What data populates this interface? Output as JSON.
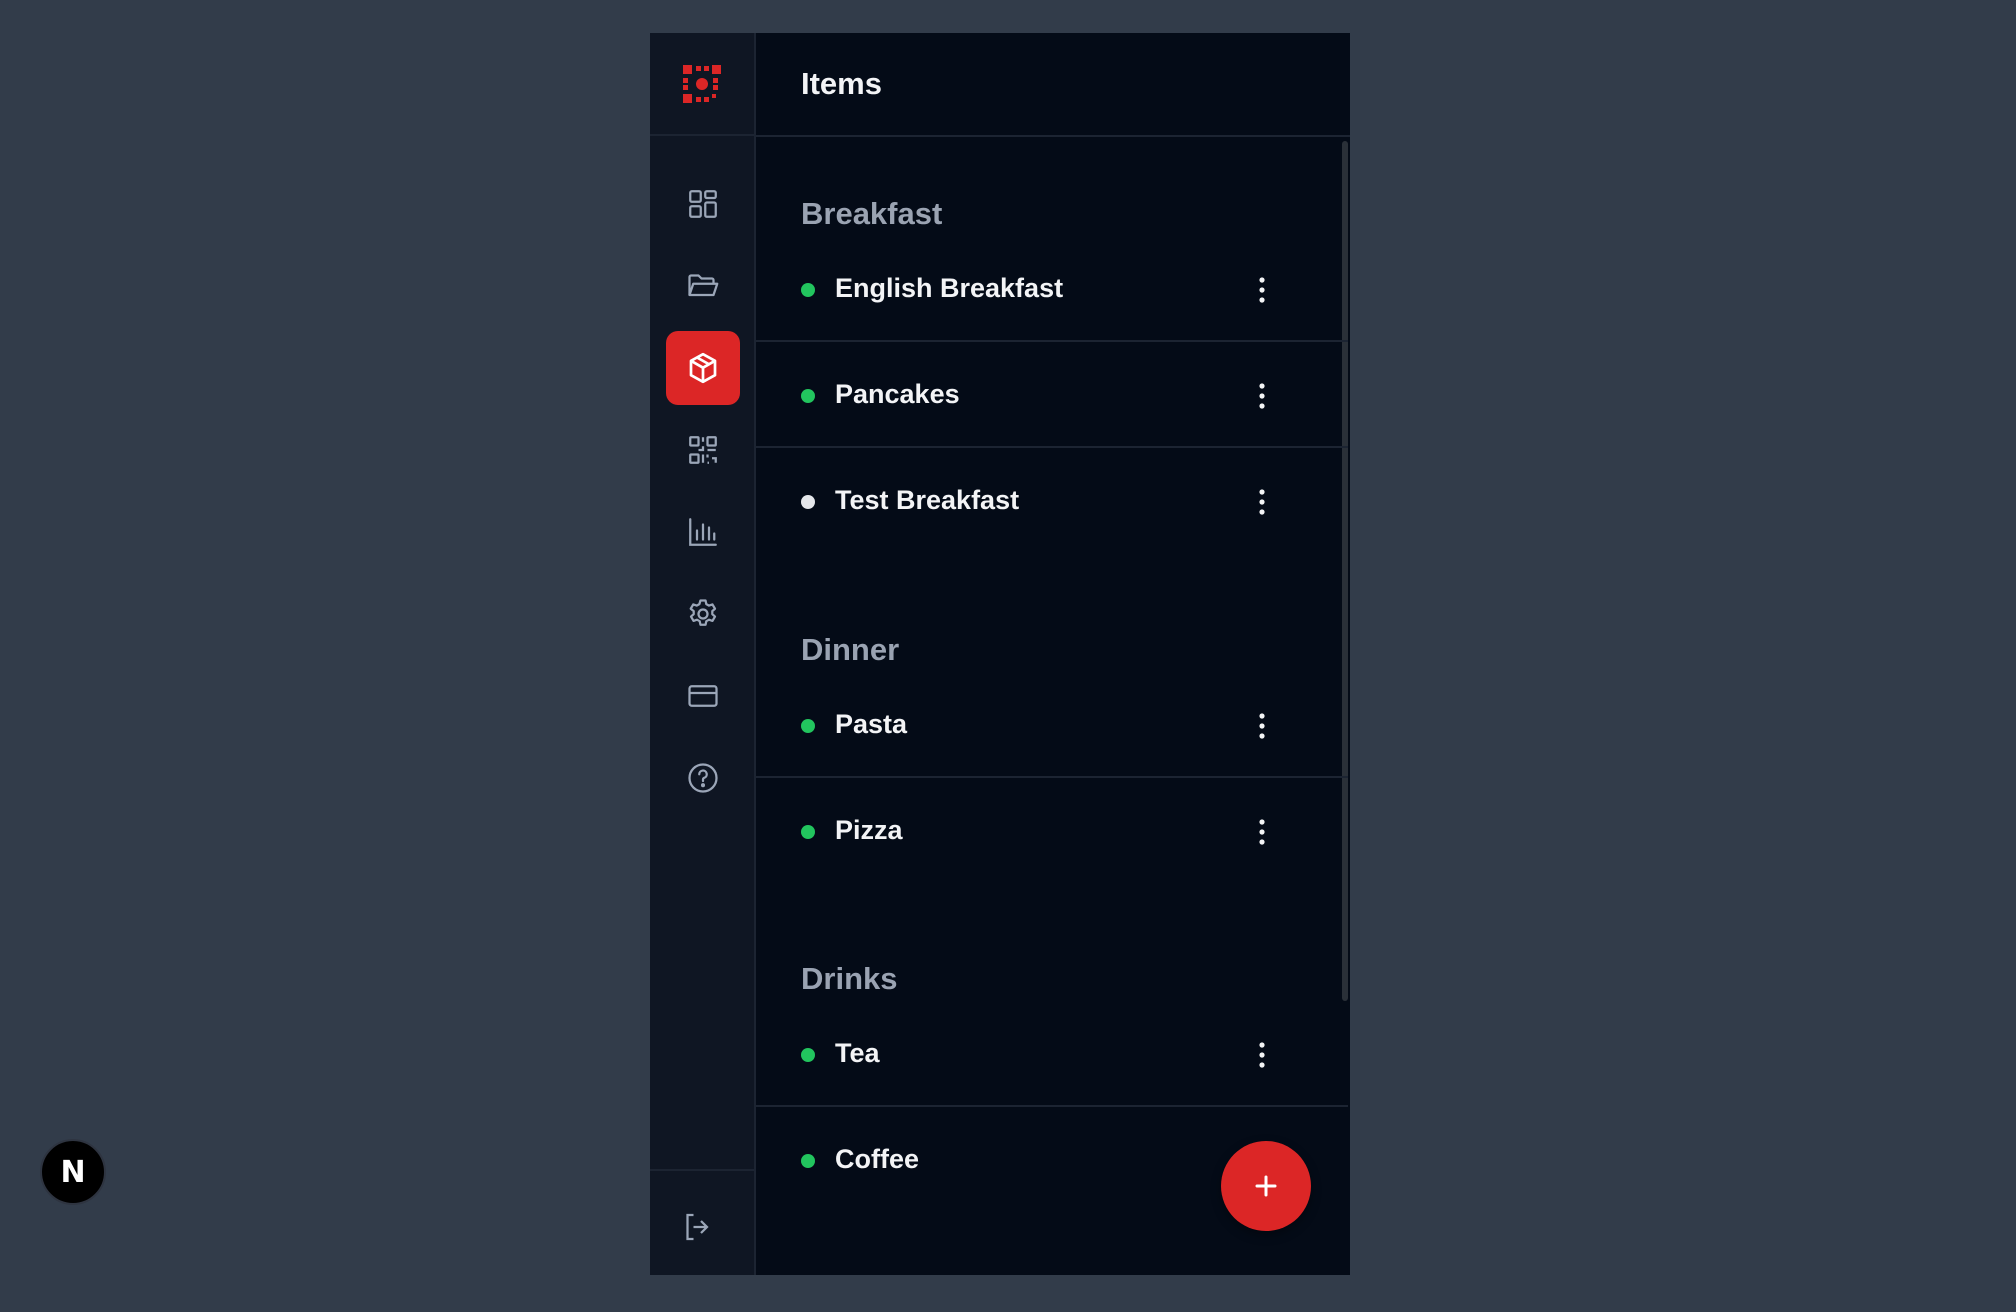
{
  "app": {
    "title": "Items"
  },
  "sidebar": {
    "logo": "app-logo",
    "items": [
      {
        "icon": "dashboard-icon",
        "active": false
      },
      {
        "icon": "folder-icon",
        "active": false
      },
      {
        "icon": "package-icon",
        "active": true
      },
      {
        "icon": "qr-code-icon",
        "active": false
      },
      {
        "icon": "bar-chart-icon",
        "active": false
      },
      {
        "icon": "gear-icon",
        "active": false
      },
      {
        "icon": "credit-card-icon",
        "active": false
      },
      {
        "icon": "help-icon",
        "active": false
      }
    ],
    "avatar_letter": "N"
  },
  "sections": [
    {
      "title": "Breakfast",
      "items": [
        {
          "label": "English Breakfast",
          "status": "active"
        },
        {
          "label": "Pancakes",
          "status": "active"
        },
        {
          "label": "Test Breakfast",
          "status": "inactive"
        }
      ]
    },
    {
      "title": "Dinner",
      "items": [
        {
          "label": "Pasta",
          "status": "active"
        },
        {
          "label": "Pizza",
          "status": "active"
        }
      ]
    },
    {
      "title": "Drinks",
      "items": [
        {
          "label": "Tea",
          "status": "active"
        },
        {
          "label": "Coffee",
          "status": "active"
        }
      ]
    }
  ],
  "fab": {
    "icon": "plus-icon"
  },
  "colors": {
    "accent": "#dc2626",
    "status_active": "#22c55e",
    "status_inactive": "#e5e7eb",
    "background": "#040b17",
    "sidebar": "#0f1623"
  }
}
